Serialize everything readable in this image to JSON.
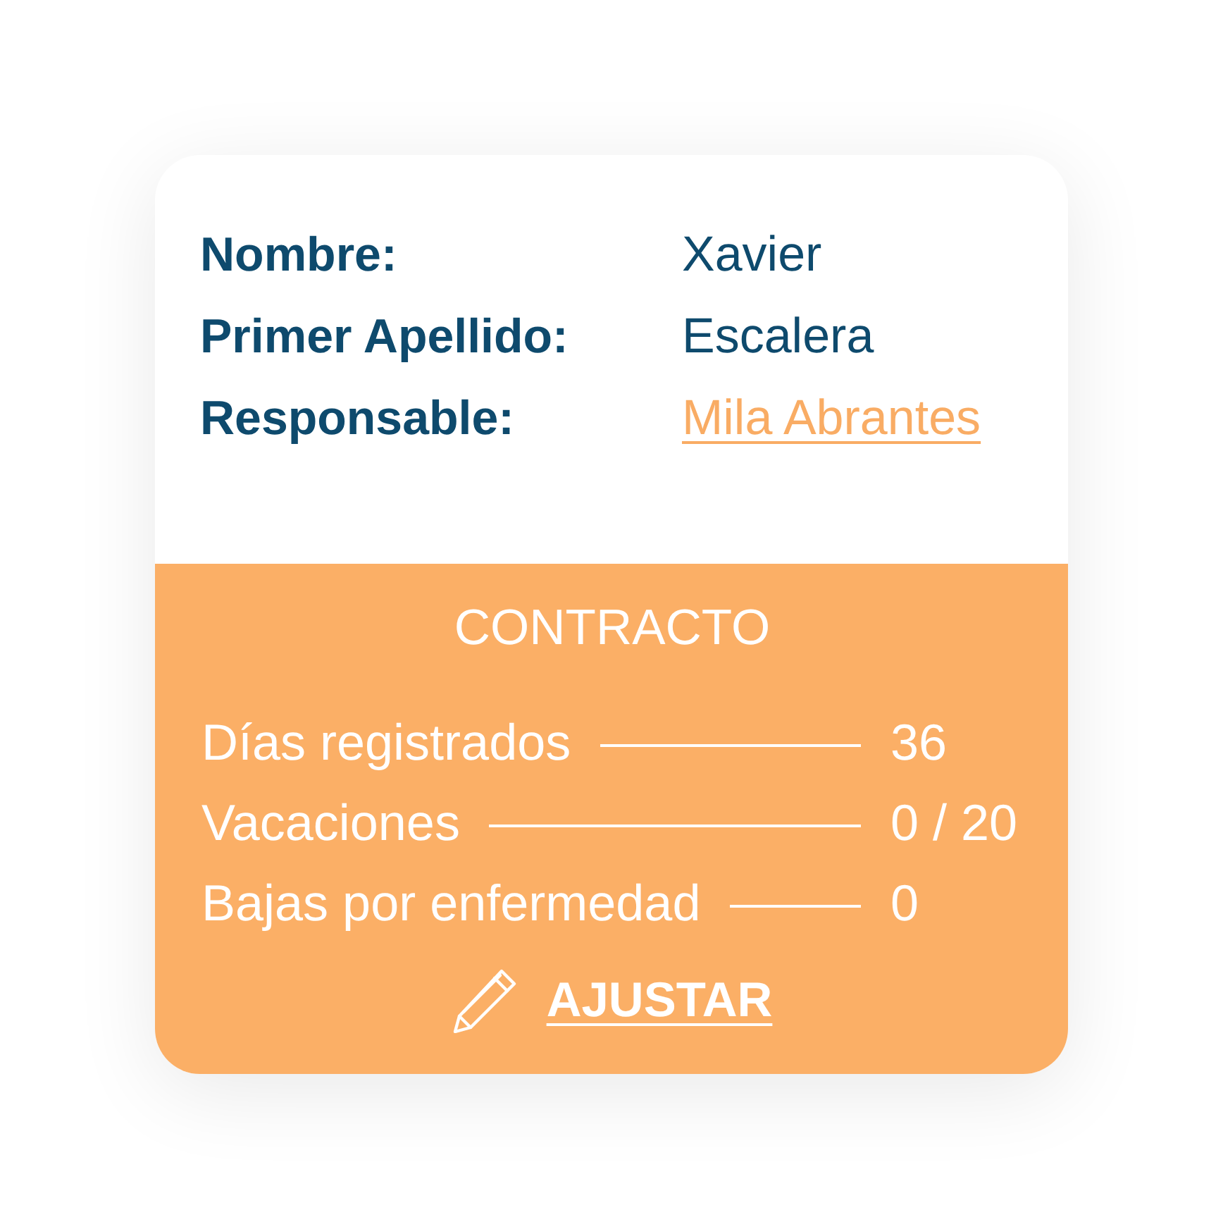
{
  "profile": {
    "fields": [
      {
        "label": "Nombre:",
        "value": "Xavier",
        "kind": "text"
      },
      {
        "label": "Primer Apellido:",
        "value": "Escalera",
        "kind": "text"
      },
      {
        "label": "Responsable:",
        "value": "Mila Abrantes",
        "kind": "link"
      }
    ]
  },
  "contract": {
    "title": "CONTRACTO",
    "stats": [
      {
        "label": "Días registrados",
        "value": "36"
      },
      {
        "label": "Vacaciones",
        "value": "0 / 20"
      },
      {
        "label": "Bajas por enfermedad",
        "value": "0"
      }
    ],
    "action": {
      "label": "AJUSTAR"
    }
  }
}
